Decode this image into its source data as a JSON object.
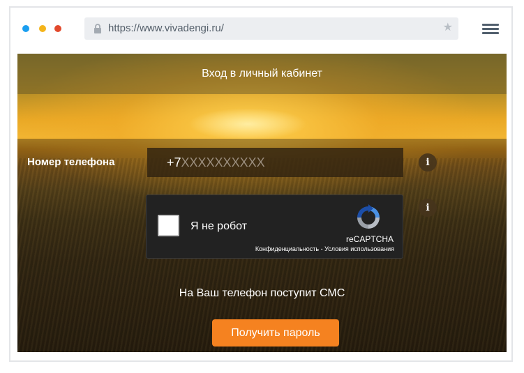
{
  "browser": {
    "url": "https://www.vivadengi.ru/",
    "icons": [
      "lock-icon",
      "star-icon",
      "hamburger-menu-icon"
    ],
    "traffic_light_colors": [
      "#1a9ef0",
      "#f4b41a",
      "#e2492c"
    ]
  },
  "page": {
    "title": "Вход в личный кабинет",
    "phone_label": "Номер телефона",
    "phone_prefix": "+7",
    "phone_placeholder": "XXXXXXXXXX",
    "info_glyph": "i",
    "captcha": {
      "checkbox_label": "Я не робот",
      "brand": "reCAPTCHA",
      "links": "Конфиденциальность - Условия использования"
    },
    "sms_notice": "На Ваш телефон поступит СМС",
    "submit_label": "Получить пароль",
    "accent_color": "#f58220"
  }
}
